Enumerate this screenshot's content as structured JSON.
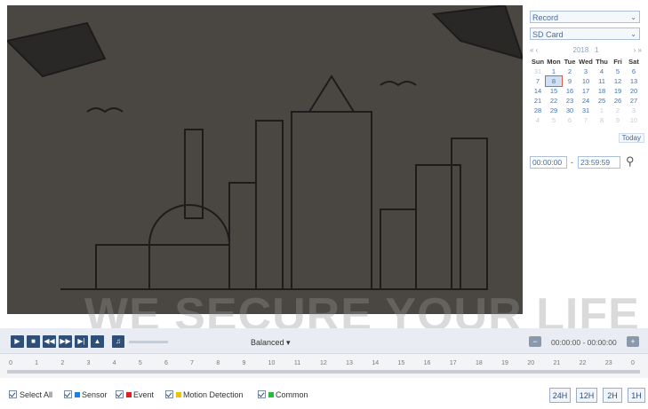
{
  "sidebar": {
    "type_select": "Record",
    "storage_select": "SD Card",
    "calendar": {
      "nav_prev": "« ‹",
      "year": "2018",
      "month": "1",
      "nav_next": "› »",
      "weekdays": [
        "Sun",
        "Mon",
        "Tue",
        "Wed",
        "Thu",
        "Fri",
        "Sat"
      ],
      "weeks": [
        [
          "31",
          "1",
          "2",
          "3",
          "4",
          "5",
          "6"
        ],
        [
          "7",
          "8",
          "9",
          "10",
          "11",
          "12",
          "13"
        ],
        [
          "14",
          "15",
          "16",
          "17",
          "18",
          "19",
          "20"
        ],
        [
          "21",
          "22",
          "23",
          "24",
          "25",
          "26",
          "27"
        ],
        [
          "28",
          "29",
          "30",
          "31",
          "1",
          "2",
          "3"
        ],
        [
          "4",
          "5",
          "6",
          "7",
          "8",
          "9",
          "10"
        ]
      ],
      "selected_day": "8",
      "today_label": "Today"
    },
    "start_time": "00:00:00",
    "time_separator": "-",
    "end_time": "23:59:59"
  },
  "controls": {
    "stream_label": "Balanced",
    "time_range": "00:00:00 - 00:00:00"
  },
  "timeline": {
    "hours": [
      "0",
      "1",
      "2",
      "3",
      "4",
      "5",
      "6",
      "7",
      "8",
      "9",
      "10",
      "11",
      "12",
      "13",
      "14",
      "15",
      "16",
      "17",
      "18",
      "19",
      "20",
      "21",
      "22",
      "23",
      "0"
    ]
  },
  "filters": {
    "select_all": "Select All",
    "sensor": "Sensor",
    "event": "Event",
    "motion": "Motion Detection",
    "common": "Common"
  },
  "colors": {
    "sensor": "#1e7fe0",
    "event": "#e02020",
    "motion": "#f2c200",
    "common": "#22c03a",
    "video_bg": "#4a4743",
    "button_bg": "#2e4f78"
  },
  "range_buttons": [
    "24H",
    "12H",
    "2H",
    "1H"
  ],
  "watermark": "WE SECURE YOUR LIFE"
}
